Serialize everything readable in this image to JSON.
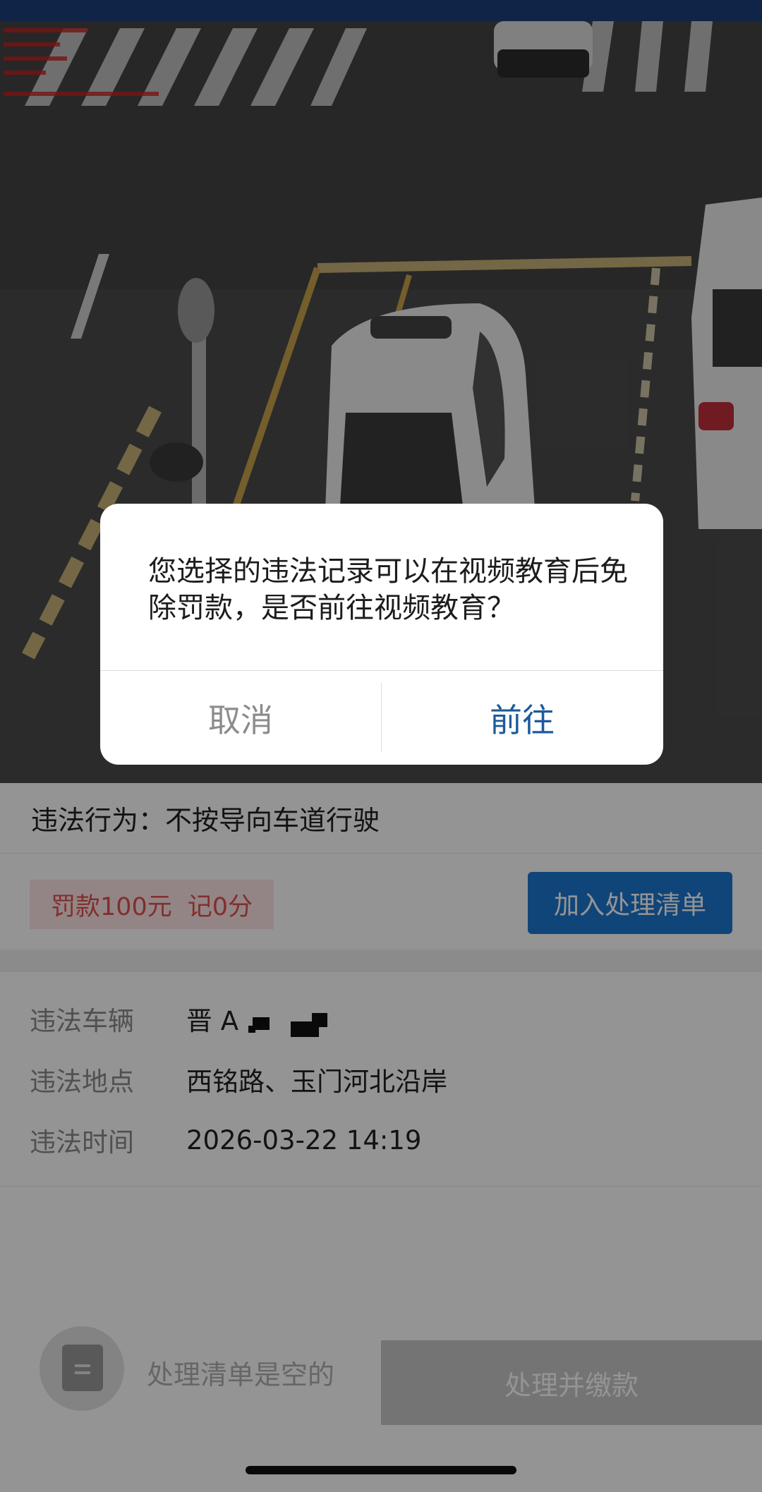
{
  "dialog": {
    "message": "您选择的违法记录可以在视频教育后免除罚款，是否前往视频教育？",
    "cancel_label": "取消",
    "confirm_label": "前往"
  },
  "record": {
    "behavior_label": "违法行为：",
    "behavior_value": "不按导向车道行驶",
    "fine_text": "罚款100元",
    "points_text": "记0分",
    "add_to_list_label": "加入处理清单"
  },
  "details": [
    {
      "label": "违法车辆",
      "value": "晋 A"
    },
    {
      "label": "违法地点",
      "value": "西铭路、玉门河北沿岸"
    },
    {
      "label": "违法时间",
      "value": "2026-03-22 14:19"
    }
  ],
  "bottom_bar": {
    "empty_text": "处理清单是空的",
    "pay_label": "处理并缴款"
  },
  "colors": {
    "primary": "#1d77d0",
    "fine_text": "#e05050",
    "fine_bg": "#fde6e6",
    "dialog_confirm": "#1e5a9c"
  }
}
